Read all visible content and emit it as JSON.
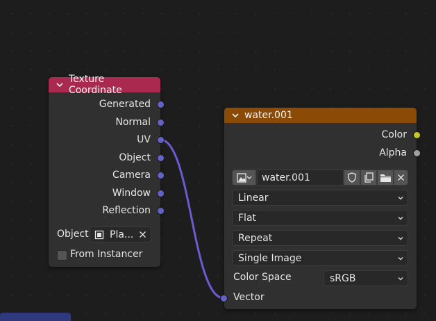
{
  "colors": {
    "texture_coord_header": "#a9294f",
    "image_header": "#8c4a07",
    "vector_socket": "#6363c7",
    "color_socket": "#c7c729",
    "gray_socket": "#a1a1a1",
    "link": "#6b5bd1"
  },
  "texture_coordinate": {
    "title": "Texture Coordinate",
    "outputs": [
      "Generated",
      "Normal",
      "UV",
      "Object",
      "Camera",
      "Window",
      "Reflection"
    ],
    "object_label": "Object:",
    "object_value": "Pla...",
    "from_instancer_label": "From Instancer"
  },
  "image_node": {
    "title": "water.001",
    "outputs": [
      "Color",
      "Alpha"
    ],
    "image_name": "water.001",
    "interpolation": "Linear",
    "projection": "Flat",
    "extension": "Repeat",
    "source": "Single Image",
    "color_space_label": "Color Space",
    "color_space_value": "sRGB",
    "vector_input": "Vector"
  },
  "icons": [
    "chevron-down-icon",
    "image-icon",
    "shield-icon",
    "duplicate-icon",
    "folder-icon",
    "close-icon",
    "object-square-icon"
  ]
}
